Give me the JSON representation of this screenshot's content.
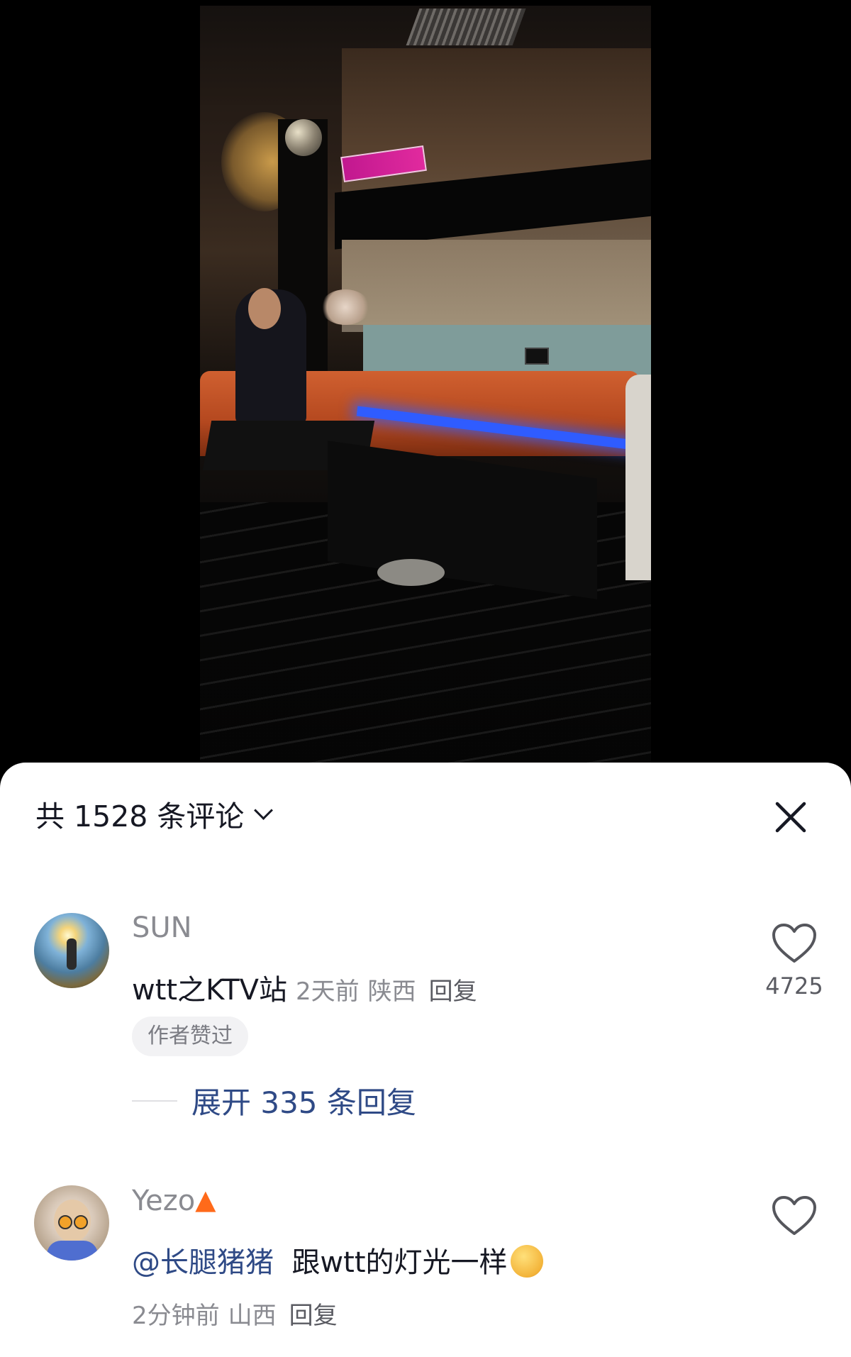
{
  "header": {
    "comment_count_label": "共 1528 条评论"
  },
  "comments": [
    {
      "username": "SUN",
      "text": "wtt之KTV站",
      "time": "2天前",
      "location": "陕西",
      "reply_label": "回复",
      "likes": "4725",
      "author_liked_badge": "作者赞过",
      "expand_replies_label": "展开 335 条回复"
    },
    {
      "username": "Yezo",
      "mention": "@长腿猪猪",
      "text": "跟wtt的灯光一样",
      "time": "2分钟前",
      "location": "山西",
      "reply_label": "回复"
    }
  ],
  "icons": {
    "close": "close-icon",
    "chevron": "chevron-down-icon",
    "like": "heart-outline-icon",
    "fire": "fire-emoji",
    "emoji": "smiling-face-emoji"
  },
  "colors": {
    "mention": "#2f4a86",
    "secondary_text": "#8a8b91",
    "primary_text": "#161823"
  }
}
